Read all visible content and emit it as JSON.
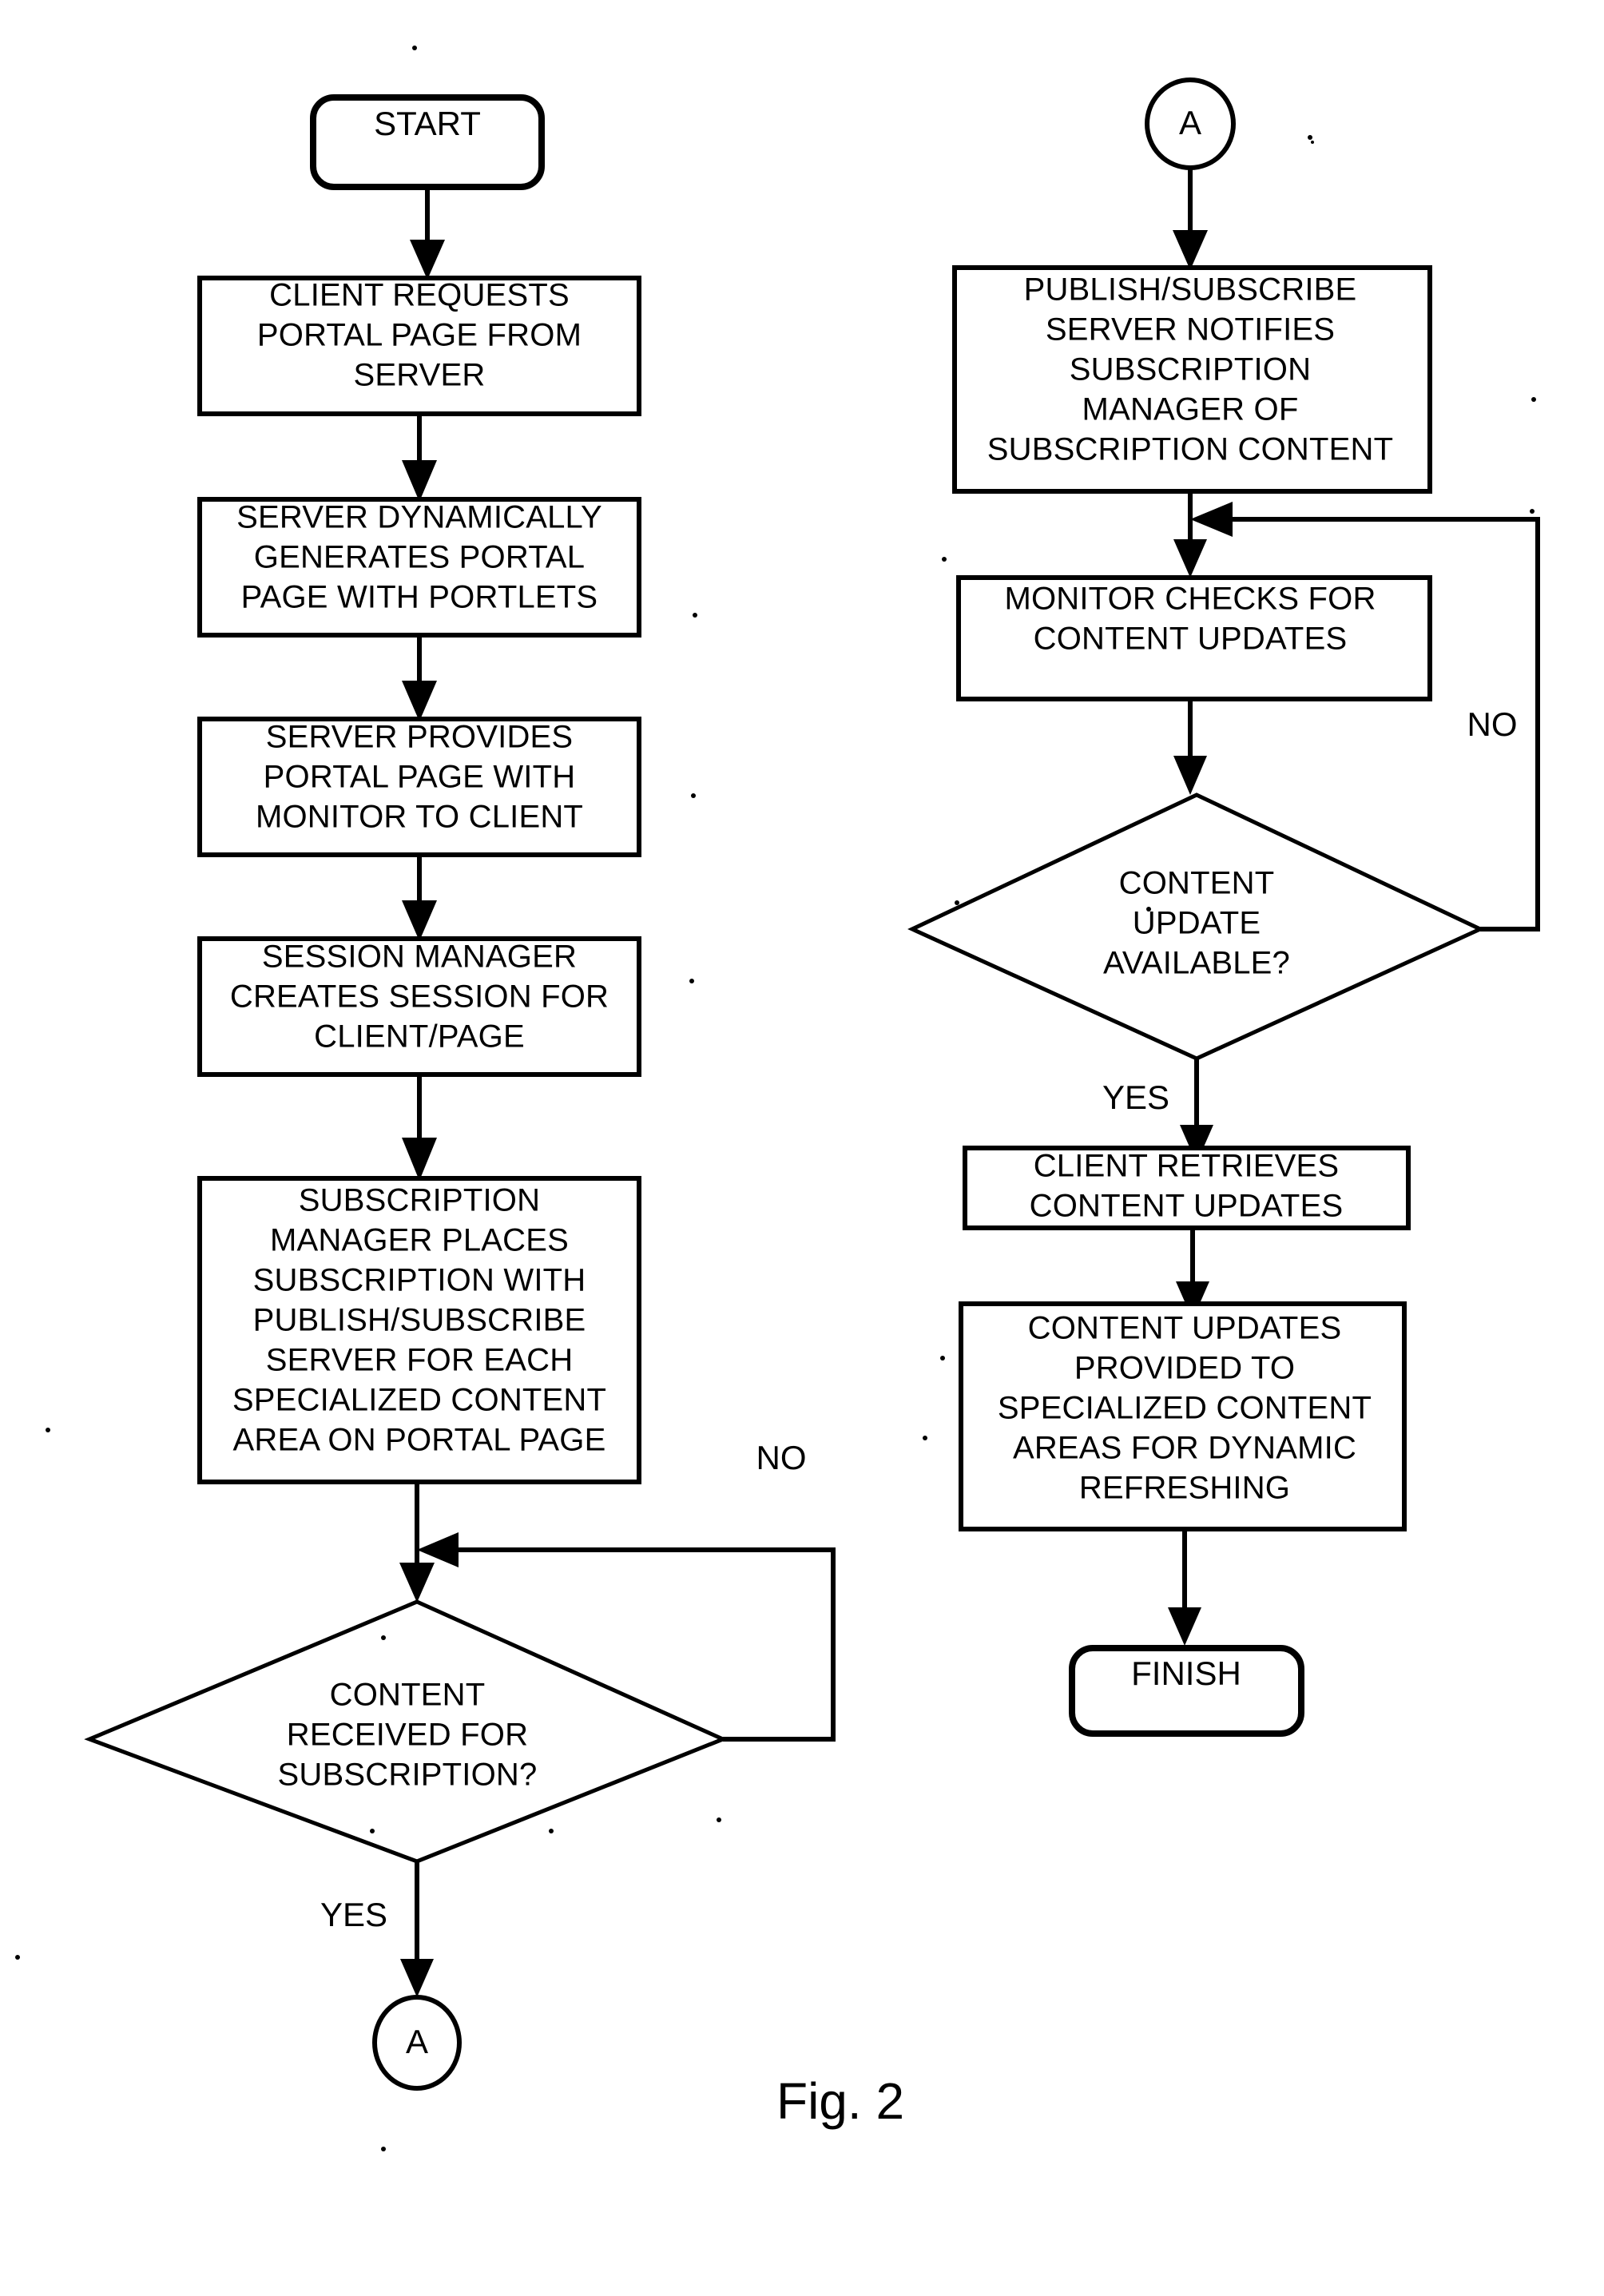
{
  "figure": {
    "caption": "Fig. 2"
  },
  "left_column": {
    "start": {
      "label": "START",
      "shape": "terminator"
    },
    "steps": [
      {
        "id": "client-requests",
        "shape": "process",
        "lines": [
          "CLIENT REQUESTS",
          "PORTAL PAGE FROM",
          "SERVER"
        ]
      },
      {
        "id": "server-generates",
        "shape": "process",
        "lines": [
          "SERVER DYNAMICALLY",
          "GENERATES PORTAL",
          "PAGE WITH PORTLETS"
        ]
      },
      {
        "id": "server-provides",
        "shape": "process",
        "lines": [
          "SERVER PROVIDES",
          "PORTAL PAGE WITH",
          "MONITOR TO CLIENT"
        ]
      },
      {
        "id": "session-manager",
        "shape": "process",
        "lines": [
          "SESSION MANAGER",
          "CREATES SESSION FOR",
          "CLIENT/PAGE"
        ]
      },
      {
        "id": "subscription-manager",
        "shape": "process",
        "lines": [
          "SUBSCRIPTION",
          "MANAGER PLACES",
          "SUBSCRIPTION WITH",
          "PUBLISH/SUBSCRIBE",
          "SERVER FOR EACH",
          "SPECIALIZED CONTENT",
          "AREA ON PORTAL PAGE"
        ]
      }
    ],
    "decision": {
      "id": "content-received",
      "shape": "decision",
      "lines": [
        "CONTENT",
        "RECEIVED FOR",
        "SUBSCRIPTION?"
      ],
      "yes_label": "YES",
      "no_label": "NO"
    },
    "connector_out": {
      "label": "A",
      "shape": "connector"
    }
  },
  "right_column": {
    "connector_in": {
      "label": "A",
      "shape": "connector"
    },
    "steps_top": [
      {
        "id": "pubsub-notifies",
        "shape": "process",
        "lines": [
          "PUBLISH/SUBSCRIBE",
          "SERVER NOTIFIES",
          "SUBSCRIPTION",
          "MANAGER OF",
          "SUBSCRIPTION CONTENT"
        ]
      },
      {
        "id": "monitor-checks",
        "shape": "process",
        "lines": [
          "MONITOR CHECKS FOR",
          "CONTENT UPDATES"
        ]
      }
    ],
    "decision": {
      "id": "content-update-available",
      "shape": "decision",
      "lines": [
        "CONTENT",
        "UPDATE",
        "AVAILABLE?"
      ],
      "yes_label": "YES",
      "no_label": "NO"
    },
    "steps_bottom": [
      {
        "id": "client-retrieves",
        "shape": "process",
        "lines": [
          "CLIENT RETRIEVES",
          "CONTENT UPDATES"
        ]
      },
      {
        "id": "updates-provided",
        "shape": "process",
        "lines": [
          "CONTENT UPDATES",
          "PROVIDED TO",
          "SPECIALIZED CONTENT",
          "AREAS FOR DYNAMIC",
          "REFRESHING"
        ]
      }
    ],
    "finish": {
      "label": "FINISH",
      "shape": "terminator"
    }
  },
  "colors": {
    "ink": "#000000",
    "paper": "#ffffff"
  }
}
